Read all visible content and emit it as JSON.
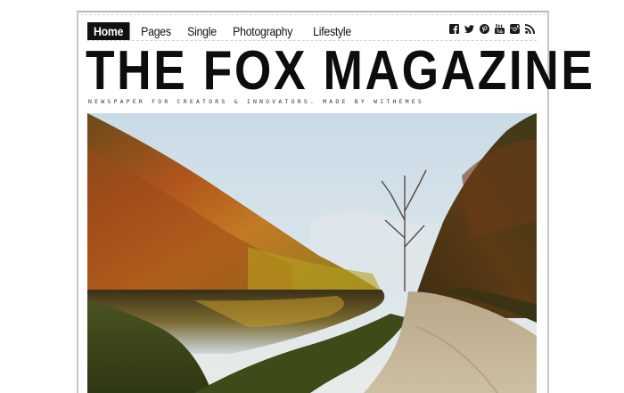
{
  "nav": {
    "items": [
      {
        "label": "Home",
        "active": true
      },
      {
        "label": "Pages",
        "active": false
      },
      {
        "label": "Single",
        "active": false
      },
      {
        "label": "Photography",
        "active": false
      },
      {
        "label": "Lifestyle",
        "active": false
      }
    ]
  },
  "social": [
    "facebook-icon",
    "twitter-icon",
    "pinterest-icon",
    "youtube-icon",
    "instagram-icon",
    "rss-icon"
  ],
  "masthead": {
    "title": "THE FOX MAGAZINE",
    "tagline": "NEWSPAPER FOR CREATORS & INNOVATORS. MADE BY WITHEMES"
  },
  "hero": {
    "image": "autumn-valley-river-road-photo"
  }
}
